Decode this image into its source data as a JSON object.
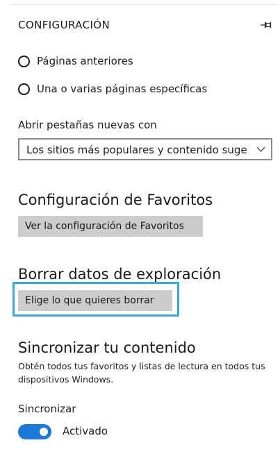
{
  "header": {
    "title": "CONFIGURACIÓN",
    "pin_icon": "pin-icon"
  },
  "startup": {
    "options": [
      {
        "label": "Páginas anteriores",
        "selected": false
      },
      {
        "label": "Una o varias páginas específicas",
        "selected": false
      }
    ]
  },
  "new_tabs": {
    "label": "Abrir pestañas nuevas con",
    "selected_value": "Los sitios más populares y contenido sugerido",
    "chevron_icon": "chevron-down-icon"
  },
  "favorites": {
    "title": "Configuración de Favoritos",
    "button_label": "Ver la configuración de Favoritos"
  },
  "browsing_data": {
    "title": "Borrar datos de exploración",
    "button_label": "Elige lo que quieres borrar",
    "highlight_color": "#3ba7d6"
  },
  "sync": {
    "title": "Sincronizar tu contenido",
    "description": "Obtén todos tus favoritos y listas de lectura en todos tus dispositivos Windows.",
    "toggle_label": "Sincronizar",
    "toggle_state": "Activado",
    "toggle_on": true,
    "toggle_color": "#1a78d6"
  }
}
